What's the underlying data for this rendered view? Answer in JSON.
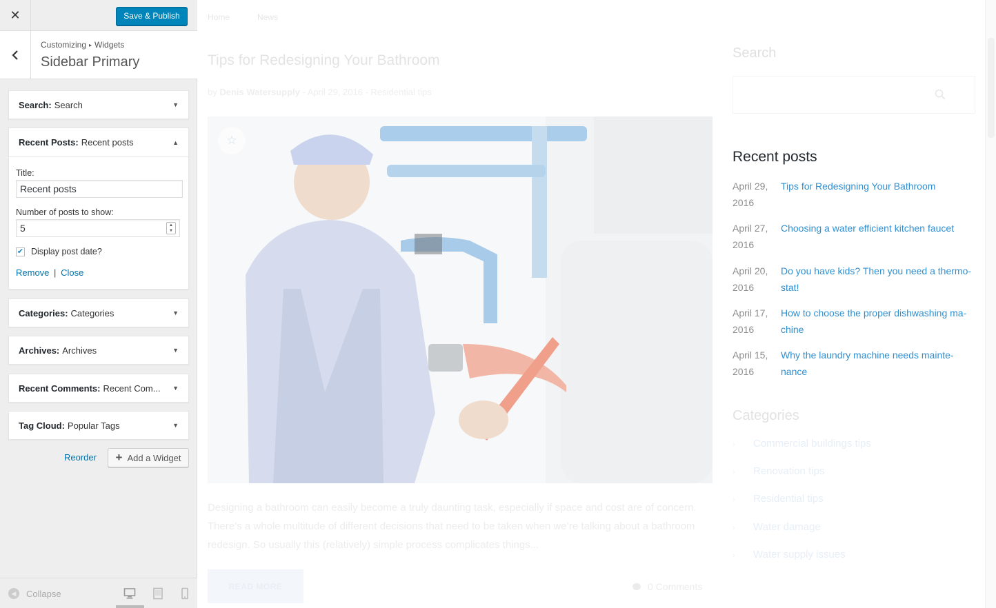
{
  "customizer": {
    "close_icon": "close-icon",
    "publish_label": "Save & Publish",
    "back_icon": "chevron-left-icon",
    "breadcrumb": {
      "parent": "Customizing",
      "child": "Widgets"
    },
    "section_title": "Sidebar Primary",
    "widgets": [
      {
        "name": "Search:",
        "title": "Search",
        "state": "collapsed"
      },
      {
        "name": "Recent Posts:",
        "title": "Recent posts",
        "state": "expanded"
      },
      {
        "name": "Categories:",
        "title": "Categories",
        "state": "collapsed"
      },
      {
        "name": "Archives:",
        "title": "Archives",
        "state": "collapsed"
      },
      {
        "name": "Recent Comments:",
        "title": "Recent Com...",
        "state": "collapsed"
      },
      {
        "name": "Tag Cloud:",
        "title": "Popular Tags",
        "state": "collapsed"
      }
    ],
    "recent_posts_form": {
      "title_label": "Title:",
      "title_value": "Recent posts",
      "number_label": "Number of posts to show:",
      "number_value": "5",
      "display_date_label": "Display post date?",
      "display_date_checked": true,
      "remove_label": "Remove",
      "separator": "|",
      "close_label": "Close"
    },
    "reorder_label": "Reorder",
    "add_widget_label": "Add a Widget",
    "footer": {
      "collapse_label": "Collapse",
      "devices": [
        "desktop",
        "tablet",
        "mobile"
      ],
      "active_device": "desktop"
    }
  },
  "preview": {
    "nav": {
      "home": "Home",
      "news": "News"
    },
    "post": {
      "title": "Tips for Redesigning Your Bathroom",
      "meta_prefix": "by",
      "author": "Denis Watersupply",
      "meta_date": "- April 29, 2016 -",
      "category": "Residential tips",
      "excerpt": "Designing a bathroom can easily become a truly daunting task, especially if space and cost are of concern. There’s a whole multitude of different decisions that need to be taken when we’re talking about a bathroom redesign. So usually this (relatively) simple process complicates things...",
      "read_more": "READ MORE",
      "comments": "0 Comments"
    },
    "sidebar": {
      "search_heading": "Search",
      "recent_heading": "Recent posts",
      "recent_posts": [
        {
          "date": "April 29, 2016",
          "title": "Tips for Redesigning Your Bathroom"
        },
        {
          "date": "April 27, 2016",
          "title": "Choosing a water efficient kitchen faucet"
        },
        {
          "date": "April 20, 2016",
          "title": "Do you have kids? Then you need a thermo-stat!"
        },
        {
          "date": "April 17, 2016",
          "title": "How to choose the proper dishwashing ma-chine"
        },
        {
          "date": "April 15, 2016",
          "title": "Why the laundry machine needs mainte-nance"
        }
      ],
      "categories_heading": "Categories",
      "categories": [
        "Commercial buildings tips",
        "Renovation tips",
        "Residential tips",
        "Water damage",
        "Water supply issues"
      ]
    }
  },
  "colors": {
    "accent": "#0085ba",
    "link": "#2f8fd0"
  }
}
